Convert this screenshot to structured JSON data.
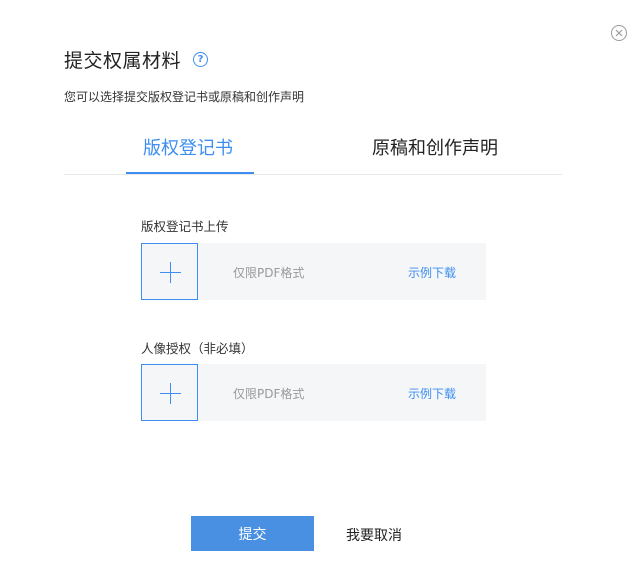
{
  "dialog": {
    "title": "提交权属材料",
    "help_icon": "question-circle-icon",
    "subtitle": "您可以选择提交版权登记书或原稿和创作声明",
    "close_icon": "close-circle-icon"
  },
  "tabs": [
    {
      "label": "版权登记书",
      "active": true
    },
    {
      "label": "原稿和创作声明",
      "active": false
    }
  ],
  "upload_fields": [
    {
      "label": "版权登记书上传",
      "hint": "仅限PDF格式",
      "example_link": "示例下载",
      "icon": "plus-icon"
    },
    {
      "label": "人像授权（非必填）",
      "hint": "仅限PDF格式",
      "example_link": "示例下载",
      "icon": "plus-icon"
    }
  ],
  "actions": {
    "submit_label": "提交",
    "cancel_label": "我要取消"
  },
  "colors": {
    "accent": "#3d8ef0",
    "submit_bg": "#4a90e2",
    "upload_bg": "#f5f6f8"
  }
}
